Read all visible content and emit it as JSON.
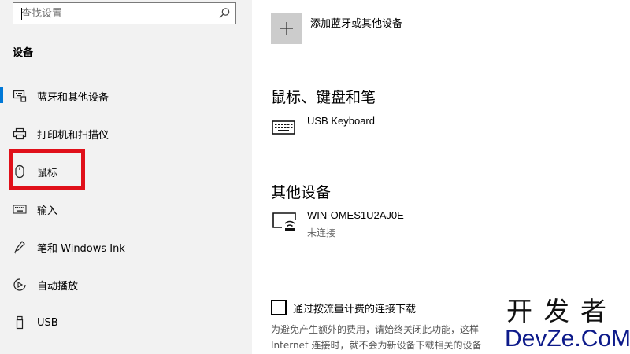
{
  "sidebar": {
    "search": {
      "placeholder": "查找设置",
      "value": ""
    },
    "section_heading": "设备",
    "items": [
      {
        "label": "蓝牙和其他设备",
        "icon": "bluetooth-devices-icon",
        "active": true
      },
      {
        "label": "打印机和扫描仪",
        "icon": "printer-icon"
      },
      {
        "label": "鼠标",
        "icon": "mouse-icon",
        "highlighted": true
      },
      {
        "label": "输入",
        "icon": "keyboard-icon"
      },
      {
        "label": "笔和 Windows Ink",
        "icon": "pen-icon"
      },
      {
        "label": "自动播放",
        "icon": "autoplay-icon"
      },
      {
        "label": "USB",
        "icon": "usb-icon"
      }
    ],
    "accent_color": "#0078d7",
    "highlight_color": "#e0101a"
  },
  "main": {
    "add_device_label": "添加蓝牙或其他设备",
    "groups": [
      {
        "title": "鼠标、键盘和笔",
        "devices": [
          {
            "name": "USB Keyboard",
            "status": "",
            "icon": "keyboard-device-icon"
          }
        ]
      },
      {
        "title": "其他设备",
        "devices": [
          {
            "name": "WIN-OMES1U2AJ0E",
            "status": "未连接",
            "icon": "wireless-display-icon"
          }
        ]
      }
    ],
    "metered": {
      "checkbox_label": "通过按流量计费的连接下载",
      "checked": false,
      "description_line1": "为避免产生额外的费用，请始终关闭此功能，这样",
      "description_line2": "Internet 连接时，就不会为新设备下载相关的设备"
    }
  },
  "watermark": {
    "top": "开发者",
    "bottom": "DevZe.CoM"
  }
}
